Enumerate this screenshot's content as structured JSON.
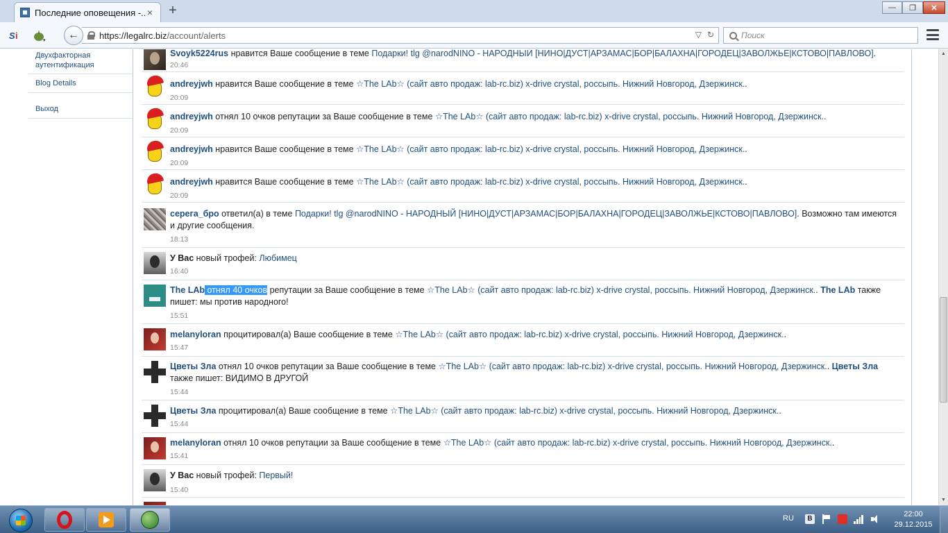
{
  "browser": {
    "tab_title": "Последние оповещения -...",
    "tab_close": "×",
    "new_tab": "+",
    "url_host": "https://legalrc.biz",
    "url_path": "/account/alerts",
    "search_placeholder": "Поиск",
    "window_buttons": {
      "minimize": "—",
      "maximize": "❐",
      "close": "✕"
    }
  },
  "sidebar": {
    "items": [
      {
        "label": "Двухфакторная аутентификация"
      },
      {
        "label": "Blog Details"
      },
      {
        "label": "Выход"
      }
    ]
  },
  "alerts": [
    {
      "user": "Svoyk5224rus",
      "action": " нравится Ваше сообщение в теме ",
      "link": "Подарки! tlg @narodNINO - НАРОДНЫЙ [НИНО|ДУСТ|АРЗАМАС|БОР|БАЛАХНА|ГОРОДЕЦ|ЗАВОЛЖЬЕ|КСТОВО|ПАВЛОВО]",
      "tail": ".",
      "time": "20:46"
    },
    {
      "user": "andreyjwh",
      "action": " нравится Ваше сообщение в теме ",
      "link": "☆The LAb☆ (сайт авто продаж: lab-rc.biz) x-drive crystal, россыпь. Нижний Новгород, Дзержинск.",
      "tail": ".",
      "time": "20:09"
    },
    {
      "user": "andreyjwh",
      "action": " отнял 10 очков репутации за Ваше сообщение в теме ",
      "link": "☆The LAb☆ (сайт авто продаж: lab-rc.biz) x-drive crystal, россыпь. Нижний Новгород, Дзержинск.",
      "tail": ".",
      "time": "20:09"
    },
    {
      "user": "andreyjwh",
      "action": " нравится Ваше сообщение в теме ",
      "link": "☆The LAb☆ (сайт авто продаж: lab-rc.biz) x-drive crystal, россыпь. Нижний Новгород, Дзержинск.",
      "tail": ".",
      "time": "20:09"
    },
    {
      "user": "andreyjwh",
      "action": " нравится Ваше сообщение в теме ",
      "link": "☆The LAb☆ (сайт авто продаж: lab-rc.biz) x-drive crystal, россыпь. Нижний Новгород, Дзержинск.",
      "tail": ".",
      "time": "20:09"
    },
    {
      "user": "серега_бро",
      "action": " ответил(а) в теме ",
      "link": "Подарки! tlg @narodNINO - НАРОДНЫЙ [НИНО|ДУСТ|АРЗАМАС|БОР|БАЛАХНА|ГОРОДЕЦ|ЗАВОЛЖЬЕ|КСТОВО|ПАВЛОВО]",
      "tail": ". Возможно там имеются и другие сообщения.",
      "time": "18:13"
    },
    {
      "user": "У Вас",
      "action": " новый трофей: ",
      "link": "Любимец",
      "tail": "",
      "time": "16:40"
    },
    {
      "user": "The LAb",
      "highlight": " отнял 40 очков",
      "action": " репутации за Ваше сообщение в теме ",
      "link": "☆The LAb☆ (сайт авто продаж: lab-rc.biz) x-drive crystal, россыпь. Нижний Новгород, Дзержинск.",
      "tail": ". ",
      "also_user": "The LAb",
      "also_text": " также пишет: мы против народного!",
      "time": "15:51"
    },
    {
      "user": "melanyloran",
      "action": " процитировал(а) Ваше сообщение в теме ",
      "link": "☆The LAb☆ (сайт авто продаж: lab-rc.biz) x-drive crystal, россыпь. Нижний Новгород, Дзержинск.",
      "tail": ".",
      "time": "15:47"
    },
    {
      "user": "Цветы Зла",
      "action": " отнял 10 очков репутации за Ваше сообщение в теме ",
      "link": "☆The LAb☆ (сайт авто продаж: lab-rc.biz) x-drive crystal, россыпь. Нижний Новгород, Дзержинск.",
      "tail": ". ",
      "also_user": "Цветы Зла",
      "also_text": " также пишет: ВИДИМО В ДРУГОЙ",
      "time": "15:44"
    },
    {
      "user": "Цветы Зла",
      "action": " процитировал(а) Ваше сообщение в теме ",
      "link": "☆The LAb☆ (сайт авто продаж: lab-rc.biz) x-drive crystal, россыпь. Нижний Новгород, Дзержинск.",
      "tail": ".",
      "time": "15:44"
    },
    {
      "user": "melanyloran",
      "action": " отнял 10 очков репутации за Ваше сообщение в теме ",
      "link": "☆The LAb☆ (сайт авто продаж: lab-rc.biz) x-drive crystal, россыпь. Нижний Новгород, Дзержинск.",
      "tail": ".",
      "time": "15:41"
    },
    {
      "user": "У Вас",
      "action": " новый трофей: ",
      "link": "Первый!",
      "tail": "",
      "time": "15:40"
    }
  ],
  "taskbar": {
    "tray_lang": "RU",
    "tray_v": "B",
    "clock_time": "22:00",
    "clock_date": "29.12.2015"
  },
  "colors": {
    "link": "#1f4f7f",
    "selection": "#3399ff",
    "taskbar": "#3d5f86"
  }
}
